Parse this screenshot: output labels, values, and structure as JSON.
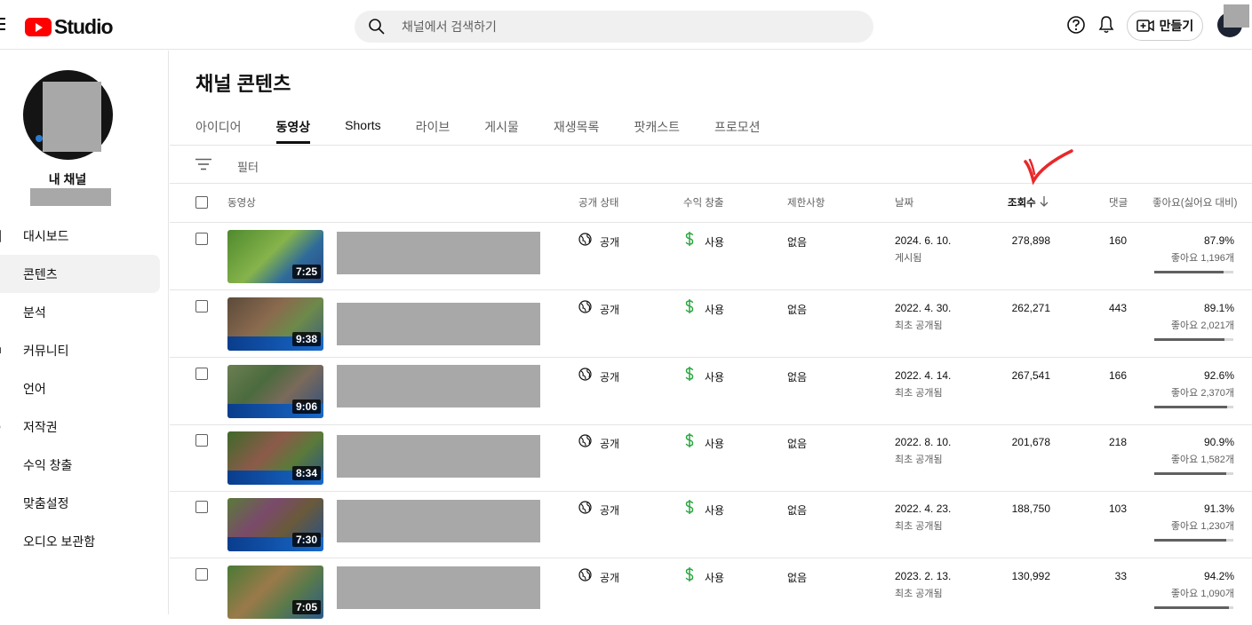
{
  "header": {
    "logo_text": "Studio",
    "search_placeholder": "채널에서 검색하기",
    "create_label": "만들기"
  },
  "sidebar": {
    "channel_label": "내 채널",
    "items": [
      {
        "label": "대시보드",
        "icon": "dashboard-icon"
      },
      {
        "label": "콘텐츠",
        "icon": "content-icon",
        "active": true
      },
      {
        "label": "분석",
        "icon": "analytics-icon"
      },
      {
        "label": "커뮤니티",
        "icon": "community-icon"
      },
      {
        "label": "언어",
        "icon": "subtitles-icon"
      },
      {
        "label": "저작권",
        "icon": "copyright-icon"
      },
      {
        "label": "수익 창출",
        "icon": "monetization-icon"
      },
      {
        "label": "맞춤설정",
        "icon": "customization-icon"
      },
      {
        "label": "오디오 보관함",
        "icon": "audio-library-icon"
      }
    ]
  },
  "main": {
    "title": "채널 콘텐츠",
    "tabs": [
      "아이디어",
      "동영상",
      "Shorts",
      "라이브",
      "게시물",
      "재생목록",
      "팟캐스트",
      "프로모션"
    ],
    "active_tab": "동영상",
    "filter_label": "필터",
    "columns": {
      "video": "동영상",
      "visibility": "공개 상태",
      "monetization": "수익 창출",
      "restrictions": "제한사항",
      "date": "날짜",
      "views": "조회수",
      "comments": "댓글",
      "likes": "좋아요(싫어요 대비)"
    },
    "rows": [
      {
        "duration": "7:25",
        "visibility": "공개",
        "monetization": "사용",
        "restrictions": "없음",
        "date": "2024. 6. 10.",
        "date_sub": "게시됨",
        "views": "278,898",
        "comments": "160",
        "like_pct": "87.9%",
        "like_count": "좋아요 1,196개",
        "like_ratio": 0.879
      },
      {
        "duration": "9:38",
        "visibility": "공개",
        "monetization": "사용",
        "restrictions": "없음",
        "date": "2022. 4. 30.",
        "date_sub": "최초 공개됨",
        "views": "262,271",
        "comments": "443",
        "like_pct": "89.1%",
        "like_count": "좋아요 2,021개",
        "like_ratio": 0.891
      },
      {
        "duration": "9:06",
        "visibility": "공개",
        "monetization": "사용",
        "restrictions": "없음",
        "date": "2022. 4. 14.",
        "date_sub": "최초 공개됨",
        "views": "267,541",
        "comments": "166",
        "like_pct": "92.6%",
        "like_count": "좋아요 2,370개",
        "like_ratio": 0.926
      },
      {
        "duration": "8:34",
        "visibility": "공개",
        "monetization": "사용",
        "restrictions": "없음",
        "date": "2022. 8. 10.",
        "date_sub": "최초 공개됨",
        "views": "201,678",
        "comments": "218",
        "like_pct": "90.9%",
        "like_count": "좋아요 1,582개",
        "like_ratio": 0.909
      },
      {
        "duration": "7:30",
        "visibility": "공개",
        "monetization": "사용",
        "restrictions": "없음",
        "date": "2022. 4. 23.",
        "date_sub": "최초 공개됨",
        "views": "188,750",
        "comments": "103",
        "like_pct": "91.3%",
        "like_count": "좋아요 1,230개",
        "like_ratio": 0.913
      },
      {
        "duration": "7:05",
        "visibility": "공개",
        "monetization": "사용",
        "restrictions": "없음",
        "date": "2023. 2. 13.",
        "date_sub": "최초 공개됨",
        "views": "130,992",
        "comments": "33",
        "like_pct": "94.2%",
        "like_count": "좋아요 1,090개",
        "like_ratio": 0.942
      }
    ]
  },
  "colors": {
    "accent_red": "#ff0000",
    "monetization_green": "#2ba640",
    "annotation_red": "#e8282b"
  }
}
